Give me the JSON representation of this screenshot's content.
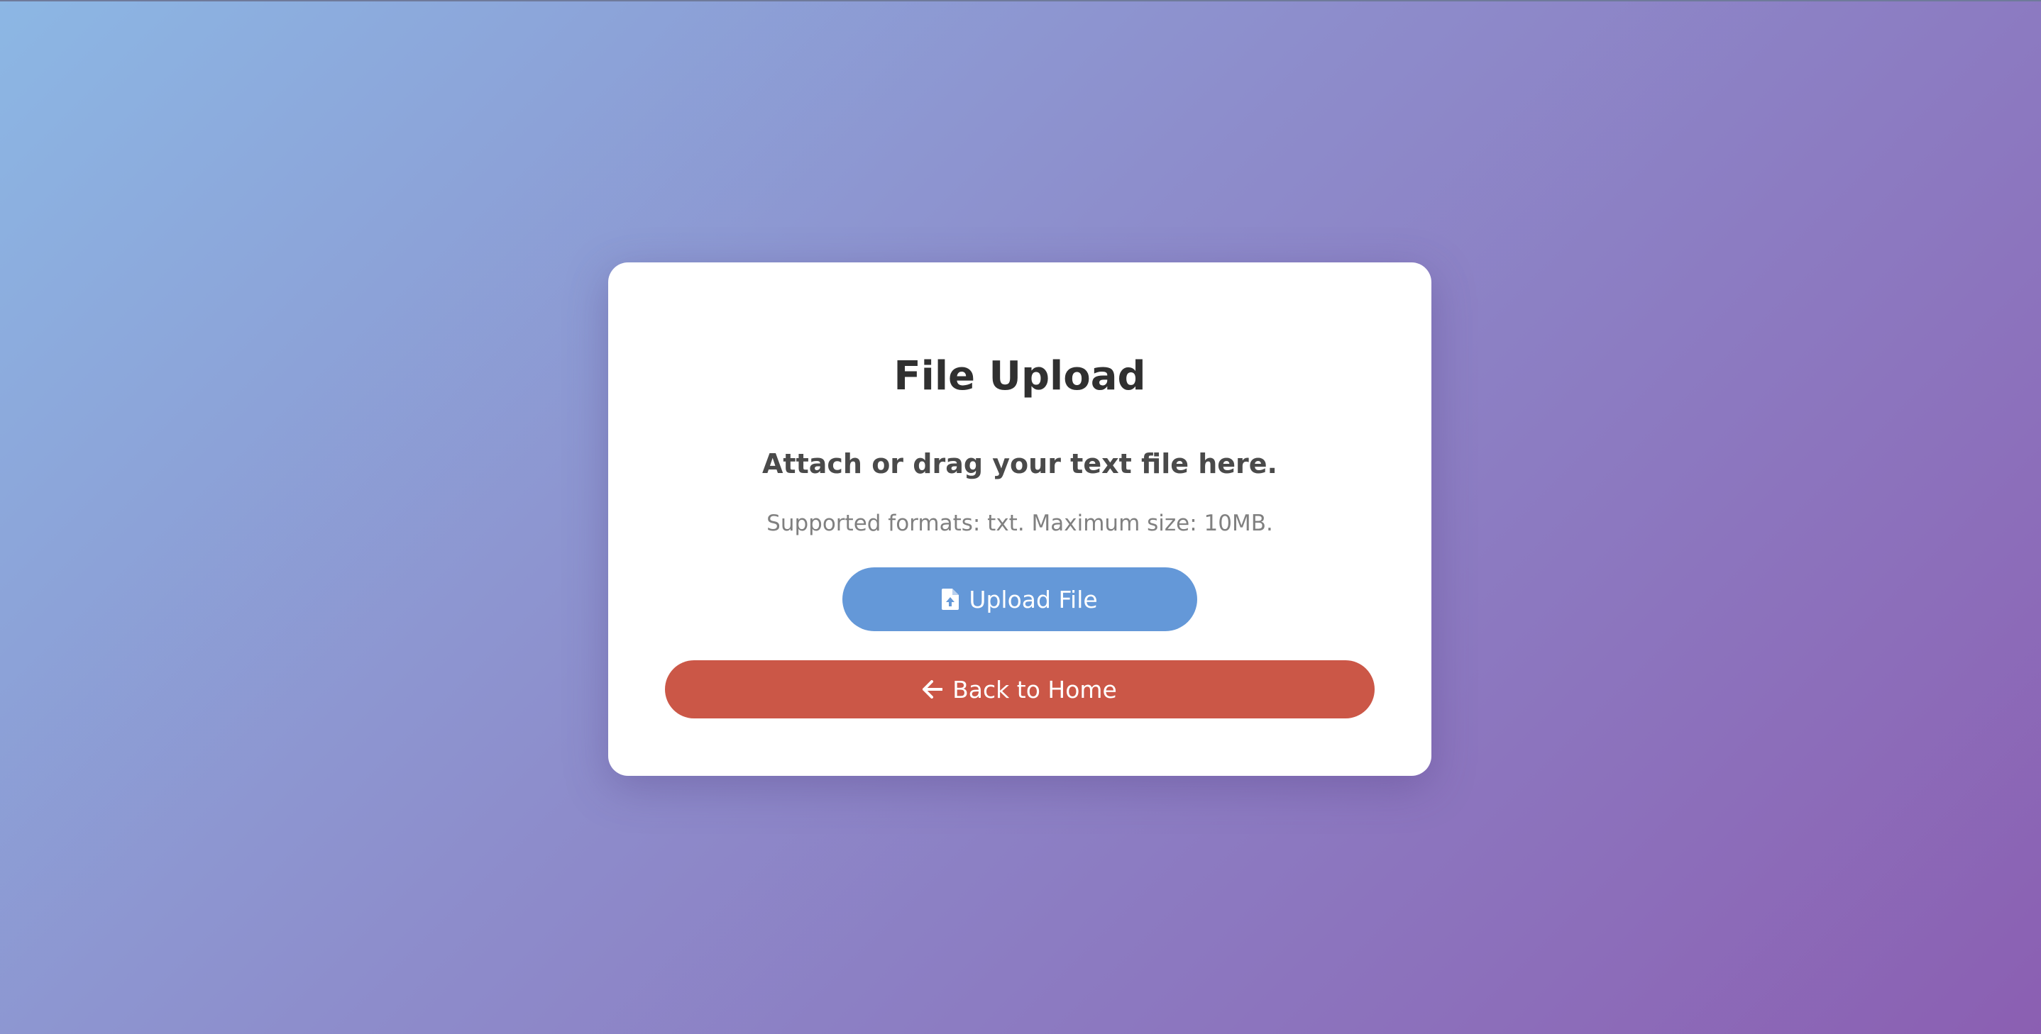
{
  "page": {
    "background_gradient": [
      "#8cb7e4",
      "#8d8ccb",
      "#8b5fb2"
    ]
  },
  "card": {
    "title": "File Upload",
    "subtitle": "Attach or drag your text file here.",
    "hint": "Supported formats: txt. Maximum size: 10MB."
  },
  "buttons": {
    "upload": {
      "label": "Upload File",
      "icon": "file-upload-icon",
      "color": "#6498d8"
    },
    "home": {
      "label": "Back to Home",
      "icon": "arrow-left-icon",
      "color": "#cb5747"
    }
  }
}
